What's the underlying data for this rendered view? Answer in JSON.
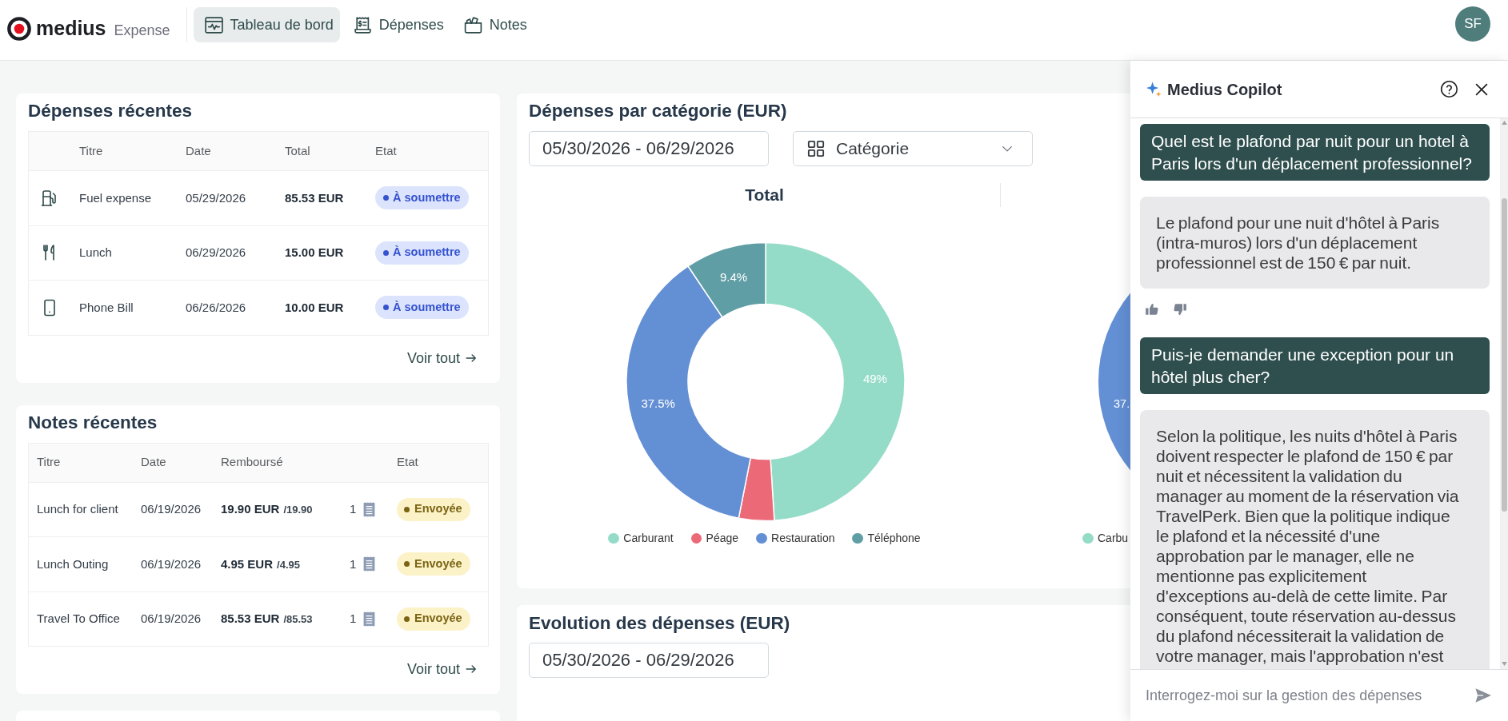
{
  "header": {
    "logo": {
      "brand": "medius",
      "product": "Expense"
    },
    "nav": [
      {
        "kind": "dashboard",
        "label": "Tableau de bord",
        "selected": true
      },
      {
        "kind": "expenses",
        "label": "Dépenses",
        "selected": false
      },
      {
        "kind": "notes",
        "label": "Notes",
        "selected": false
      }
    ],
    "avatar": {
      "initials": "SF"
    }
  },
  "recent_expenses": {
    "title": "Dépenses récentes",
    "columns": [
      "Titre",
      "Date",
      "Total",
      "Etat"
    ],
    "rows": [
      {
        "kind": "fuel",
        "title": "Fuel expense",
        "date": "05/29/2026",
        "total": "85.53 EUR",
        "status": "À soumettre"
      },
      {
        "kind": "meal",
        "title": "Lunch",
        "date": "06/29/2026",
        "total": "15.00 EUR",
        "status": "À soumettre"
      },
      {
        "kind": "phone",
        "title": "Phone Bill",
        "date": "06/26/2026",
        "total": "10.00 EUR",
        "status": "À soumettre"
      }
    ],
    "view_all": "Voir tout"
  },
  "recent_notes": {
    "title": "Notes récentes",
    "columns": [
      "Titre",
      "Date",
      "Remboursé",
      "Etat"
    ],
    "rows": [
      {
        "title": "Lunch for client",
        "date": "06/19/2026",
        "reimbursed": "19.90 EUR",
        "of_total": "/19.90",
        "receipts": "1",
        "status": "Envoyée"
      },
      {
        "title": "Lunch Outing",
        "date": "06/19/2026",
        "reimbursed": "4.95 EUR",
        "of_total": "/4.95",
        "receipts": "1",
        "status": "Envoyée"
      },
      {
        "title": "Travel To Office",
        "date": "06/19/2026",
        "reimbursed": "85.53 EUR",
        "of_total": "/85.53",
        "receipts": "1",
        "status": "Envoyée"
      }
    ],
    "view_all": "Voir tout"
  },
  "category_spending": {
    "title": "Dépenses par catégorie (EUR)",
    "date_range": "05/30/2026 - 06/29/2026",
    "group_by": "Catégorie",
    "chart_data": {
      "type": "donut",
      "title": "Total",
      "categories": [
        "Carburant",
        "Péage",
        "Restauration",
        "Téléphone"
      ],
      "values": [
        49,
        4.1,
        37.5,
        9.4
      ],
      "colors": [
        "#94dcc8",
        "#ec6977",
        "#638fd4",
        "#609ea5"
      ],
      "value_labels": [
        "49%",
        null,
        "37.5%",
        "9.4%"
      ],
      "legend": "bottom"
    },
    "second_chart": {
      "slice_label": "37.",
      "legend": [
        {
          "label": "Carbu",
          "color": "#94dcc8"
        }
      ]
    }
  },
  "spending_trend": {
    "title": "Evolution des dépenses (EUR)",
    "date_range": "05/30/2026 - 06/29/2026"
  },
  "copilot": {
    "title": "Medius Copilot",
    "messages": [
      {
        "kind": "user",
        "text": "Quel est le plafond par nuit pour un hotel à Paris lors d'un déplacement professionnel?"
      },
      {
        "kind": "assistant",
        "text": "Le plafond pour une nuit d'hôtel à Paris (intra-muros) lors d'un déplacement professionnel est de 150 € par nuit.",
        "feedback": true
      },
      {
        "kind": "user",
        "text": "Puis-je demander une exception pour un hôtel plus cher?"
      },
      {
        "kind": "assistant",
        "text": "Selon la politique, les nuits d'hôtel à Paris doivent respecter le plafond de 150 € par nuit et nécessitent la validation du manager au moment de la réservation via TravelPerk. Bien que la politique indique le plafond et la nécessité d'une approbation par le manager, elle ne mentionne pas explicitement d'exceptions au-delà de cette limite. Par conséquent, toute réservation au-dessus du plafond nécessiterait la validation de votre manager, mais l'approbation n'est"
      }
    ],
    "input": {
      "placeholder": "Interrogez-moi sur la gestion des dépenses"
    }
  }
}
